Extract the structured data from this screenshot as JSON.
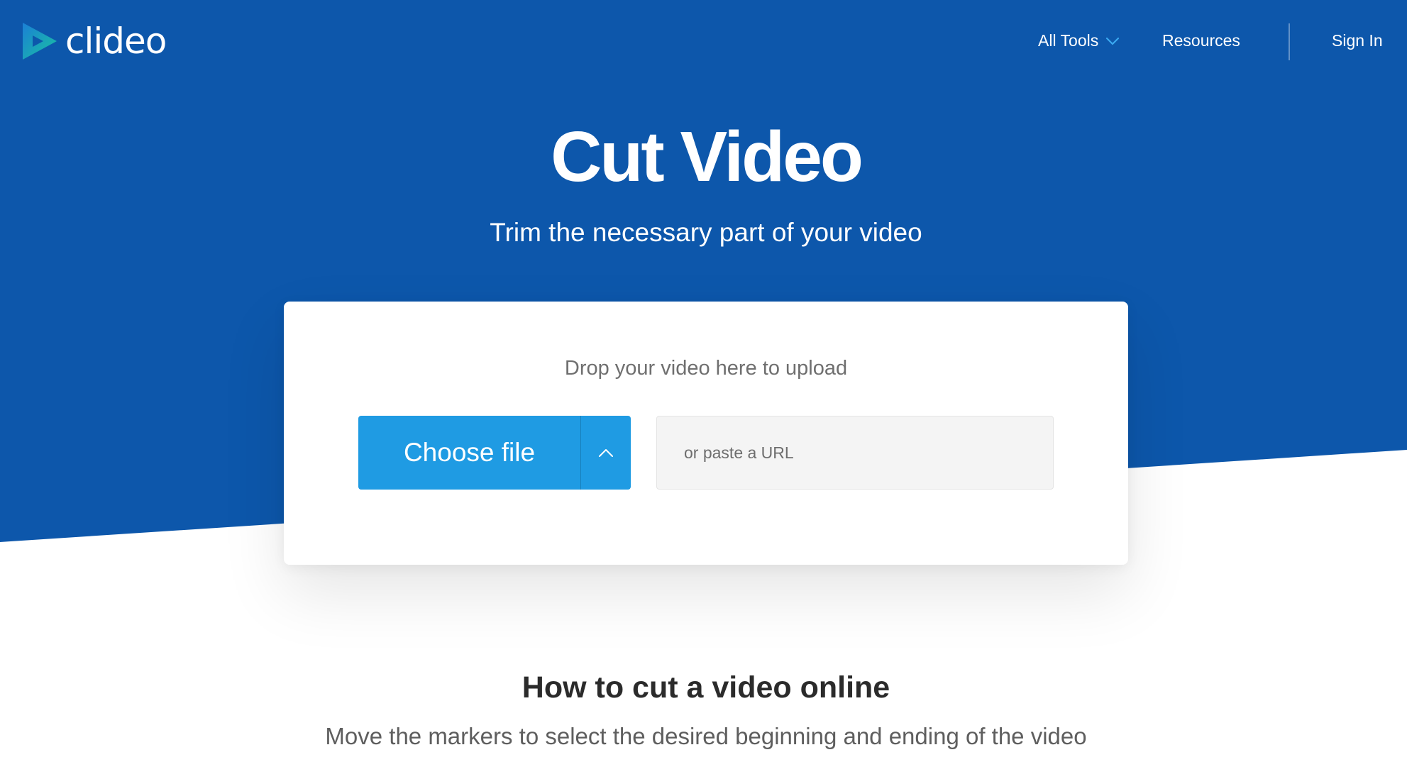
{
  "colors": {
    "hero_blue": "#0d57ab",
    "button_blue": "#1f9be3",
    "logo_teal": "#19c2a0",
    "logo_blue": "#1b7fd6",
    "white": "#ffffff"
  },
  "header": {
    "logo": {
      "text": "clideo",
      "icon": "play-triangle-logo-icon"
    },
    "nav": {
      "all_tools": "All Tools",
      "all_tools_icon": "chevron-down-icon",
      "resources": "Resources",
      "sign_in": "Sign In"
    }
  },
  "hero": {
    "title": "Cut Video",
    "subtitle": "Trim the necessary part of your video"
  },
  "upload": {
    "drop_text": "Drop your video here to upload",
    "choose_file_label": "Choose file",
    "choose_file_icon": "chevron-up-icon",
    "url_placeholder": "or paste a URL",
    "url_value": ""
  },
  "howto": {
    "title": "How to cut a video online",
    "text": "Move the markers to select the desired beginning and ending of the video"
  }
}
